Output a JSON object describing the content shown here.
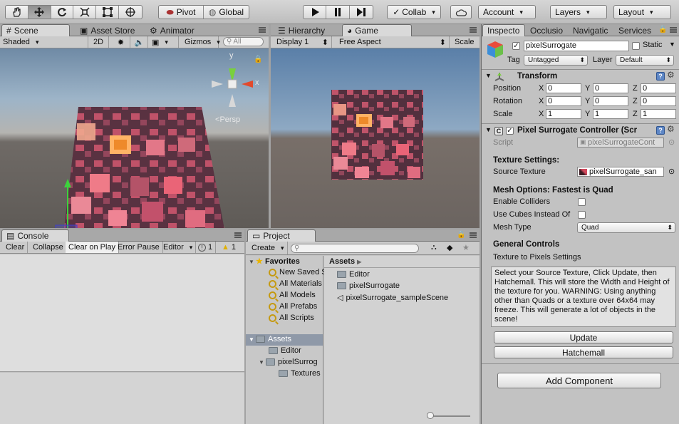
{
  "toolbar": {
    "tools": [
      "hand-tool-icon",
      "move-tool-icon",
      "rotate-tool-icon",
      "scale-tool-icon",
      "rect-tool-icon",
      "transform-tool-icon"
    ],
    "pivot": "Pivot",
    "global": "Global",
    "collab": "Collab",
    "account": "Account",
    "layers": "Layers",
    "layout": "Layout"
  },
  "scene": {
    "tabs": [
      "Scene",
      "Asset Store",
      "Animator"
    ],
    "shading": "Shaded",
    "mode2d": "2D",
    "gizmos": "Gizmos",
    "search_placeholder": "All",
    "axis_y": "y",
    "axis_x": "x",
    "persp": "Persp"
  },
  "game": {
    "tabs": [
      "Hierarchy",
      "Game"
    ],
    "display": "Display 1",
    "aspect": "Free Aspect",
    "scale": "Scale"
  },
  "console": {
    "tab": "Console",
    "buttons": [
      "Clear",
      "Collapse",
      "Clear on Play",
      "Error Pause",
      "Editor"
    ],
    "info_count": "1",
    "warn_count": "1"
  },
  "project": {
    "tab": "Project",
    "create": "Create",
    "favorites_label": "Favorites",
    "favorites": [
      "New Saved S",
      "All Materials",
      "All Models",
      "All Prefabs",
      "All Scripts"
    ],
    "tree_assets": "Assets",
    "tree": [
      "Editor",
      "pixelSurrog",
      "Textures"
    ],
    "breadcrumb": "Assets",
    "items": [
      "Editor",
      "pixelSurrogate",
      "pixelSurrogate_sampleScene"
    ]
  },
  "inspector": {
    "tabs": [
      "Inspecto",
      "Occlusio",
      "Navigatic",
      "Services"
    ],
    "object_name": "pixelSurrogate",
    "static_label": "Static",
    "tag_label": "Tag",
    "tag_value": "Untagged",
    "layer_label": "Layer",
    "layer_value": "Default",
    "transform": {
      "title": "Transform",
      "rows": [
        {
          "label": "Position",
          "x": "0",
          "y": "0",
          "z": "0"
        },
        {
          "label": "Rotation",
          "x": "0",
          "y": "0",
          "z": "0"
        },
        {
          "label": "Scale",
          "x": "1",
          "y": "1",
          "z": "1"
        }
      ],
      "axis_x": "X",
      "axis_y": "Y",
      "axis_z": "Z"
    },
    "component": {
      "title": "Pixel Surrogate Controller (Scr",
      "script_label": "Script",
      "script_value": "pixelSurrogateCont",
      "texture_settings": "Texture Settings:",
      "source_texture_label": "Source Texture",
      "source_texture_value": "pixelSurrogate_san",
      "mesh_options": "Mesh Options: Fastest is Quad",
      "enable_colliders": "Enable Colliders",
      "use_cubes": "Use Cubes Instead Of",
      "mesh_type_label": "Mesh Type",
      "mesh_type_value": "Quad",
      "general_controls": "General Controls",
      "texture_to_pixels": "Texture to Pixels Settings",
      "help_text": "Select your Source Texture, Click Update, then Hatchemall. This will store the Width and Height of the texture for you. WARNING: Using anything other than Quads or a texture over 64x64 may freeze. This will generate a lot of objects in the scene!",
      "update": "Update",
      "hatchemall": "Hatchemall"
    },
    "add_component": "Add Component"
  }
}
